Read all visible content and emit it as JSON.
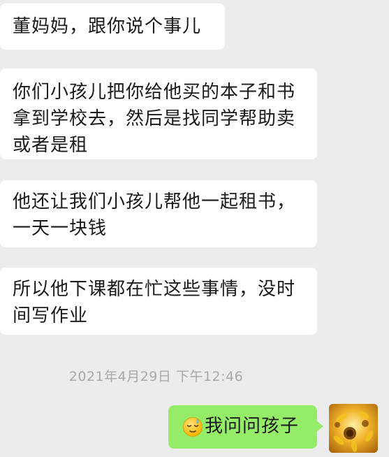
{
  "chat": {
    "messages": [
      {
        "side": "left",
        "text": "董妈妈，跟你说个事儿"
      },
      {
        "side": "left",
        "text": "你们小孩儿把你给他买的本子和书\n拿到学校去，然后是找同学帮助卖\n或者是租"
      },
      {
        "side": "left",
        "text": "他还让我们小孩儿帮他一起租书，\n一天一块钱"
      },
      {
        "side": "left",
        "text": "所以他下课都在忙这些事情，没时\n间写作业"
      }
    ],
    "timestamp": "2021年4月29日 下午12:46",
    "reply": {
      "side": "right",
      "emoji": "sleepy-face-icon",
      "text": "我问问孩子"
    }
  },
  "colors": {
    "background": "#ececec",
    "incoming_bubble": "#ffffff",
    "outgoing_bubble": "#95ec69",
    "timestamp_text": "#a8a8a8"
  },
  "avatar": {
    "icon": "sunflower-avatar"
  }
}
